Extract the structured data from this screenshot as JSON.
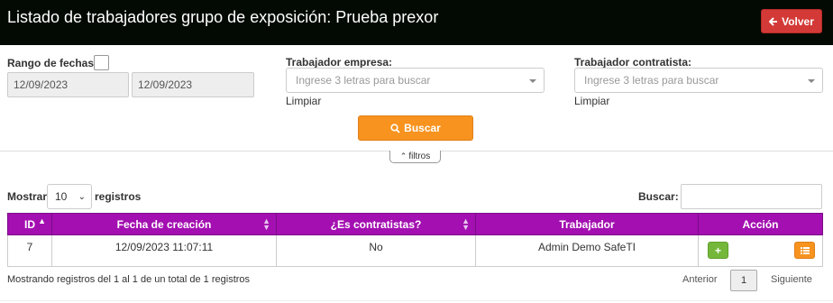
{
  "header": {
    "title": "Listado de trabajadores grupo de exposición: Prueba prexor",
    "back_label": "Volver"
  },
  "filters": {
    "date_range_label": "Rango de fechas:",
    "date_from": "12/09/2023",
    "date_to": "12/09/2023",
    "worker_company_label": "Trabajador empresa:",
    "worker_company_placeholder": "Ingrese 3 letras para buscar",
    "worker_company_clear": "Limpiar",
    "worker_contractor_label": "Trabajador contratista:",
    "worker_contractor_placeholder": "Ingrese 3 letras para buscar",
    "worker_contractor_clear": "Limpiar",
    "search_label": "Buscar",
    "toggle_label": "filtros"
  },
  "table_controls": {
    "show_label": "Mostrar",
    "page_length": "10",
    "records_label": "registros",
    "search_label": "Buscar:"
  },
  "table": {
    "headers": [
      "ID",
      "Fecha de creación",
      "¿Es contratistas?",
      "Trabajador",
      "Acción"
    ],
    "rows": [
      {
        "id": "7",
        "created": "12/09/2023 11:07:11",
        "is_contractor": "No",
        "worker": "Admin Demo SafeTI"
      }
    ],
    "add_label": "+"
  },
  "footer": {
    "info": "Mostrando registros del 1 al 1 de un total de 1 registros",
    "prev": "Anterior",
    "current_page": "1",
    "next": "Siguiente"
  },
  "colors": {
    "header_bg": "#030a03",
    "back_button": "#d33a37",
    "accent_orange": "#f7931e",
    "table_header": "#a30fb1",
    "add_button": "#75b73a"
  }
}
